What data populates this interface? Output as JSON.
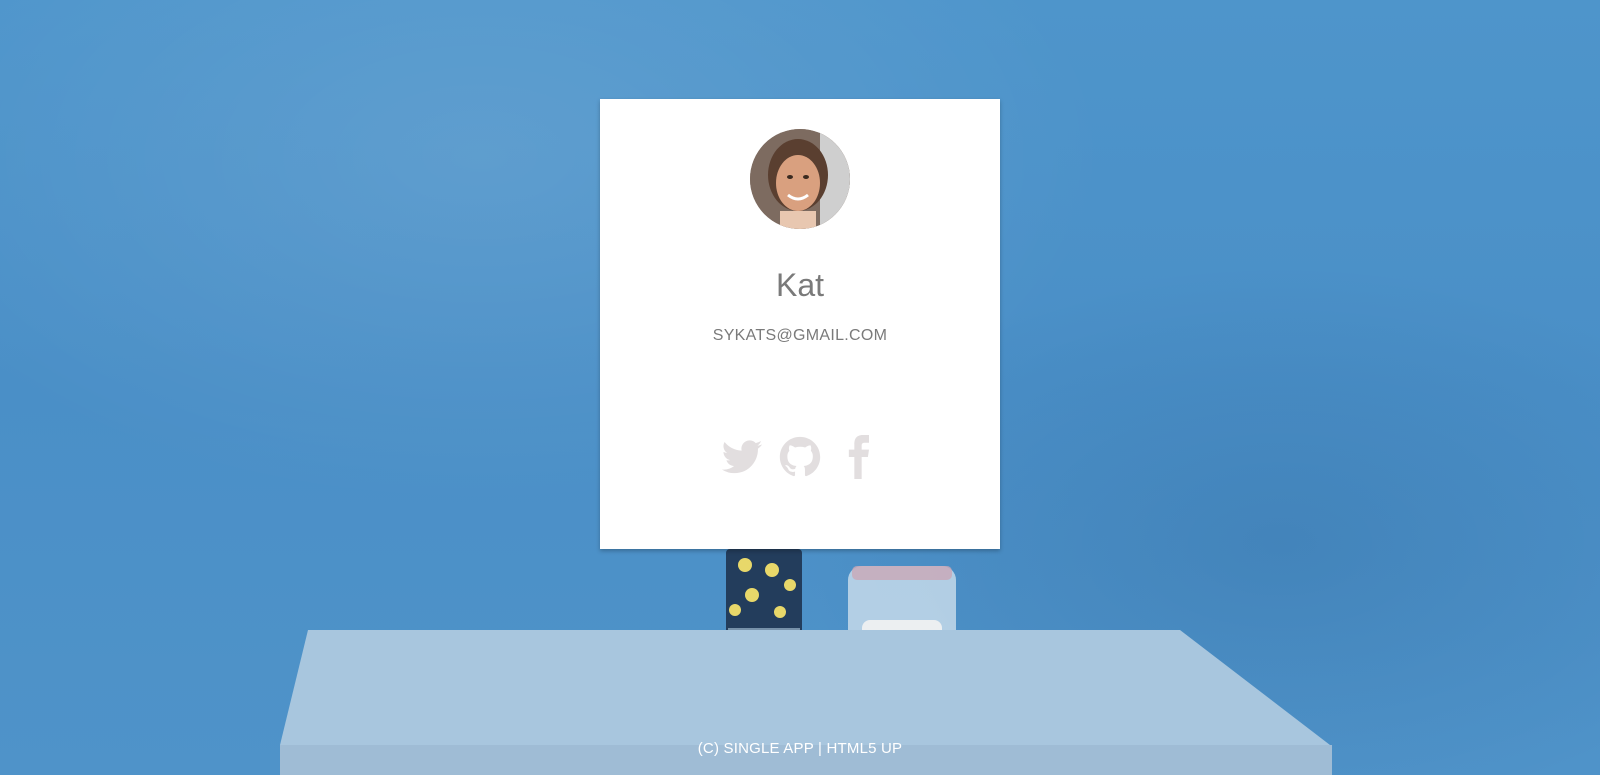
{
  "profile": {
    "name": "Kat",
    "email": "SYKATS@GMAIL.COM"
  },
  "socials": [
    {
      "icon": "twitter-icon"
    },
    {
      "icon": "github-icon"
    },
    {
      "icon": "facebook-icon"
    }
  ],
  "footer": {
    "copyright": "(C) SINGLE APP",
    "separator": " | ",
    "credit": "HTML5 UP"
  },
  "colors": {
    "background": "#4a90c6",
    "card": "#ffffff",
    "text": "#7a7a7a",
    "icon": "#e2dedf"
  }
}
